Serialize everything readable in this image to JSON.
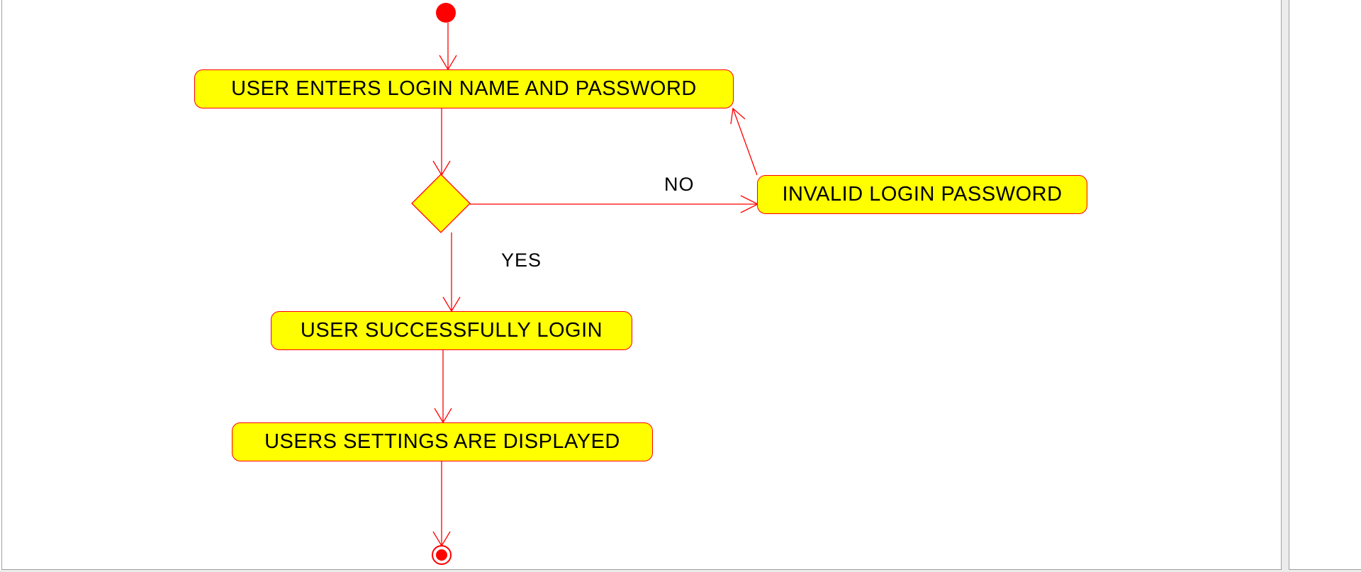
{
  "diagram": {
    "type": "activity",
    "colors": {
      "fill": "#ffff00",
      "stroke": "#ff0000",
      "start": "#ff0000"
    },
    "nodes": {
      "enter_credentials": "USER ENTERS LOGIN NAME AND PASSWORD",
      "invalid": "INVALID LOGIN PASSWORD",
      "success": "USER SUCCESSFULLY LOGIN",
      "settings": "USERS SETTINGS ARE DISPLAYED"
    },
    "labels": {
      "no": "NO",
      "yes": "YES"
    },
    "edges": [
      [
        "start",
        "enter_credentials"
      ],
      [
        "enter_credentials",
        "decision"
      ],
      [
        "decision",
        "invalid",
        "NO"
      ],
      [
        "invalid",
        "enter_credentials"
      ],
      [
        "decision",
        "success",
        "YES"
      ],
      [
        "success",
        "settings"
      ],
      [
        "settings",
        "end"
      ]
    ]
  }
}
